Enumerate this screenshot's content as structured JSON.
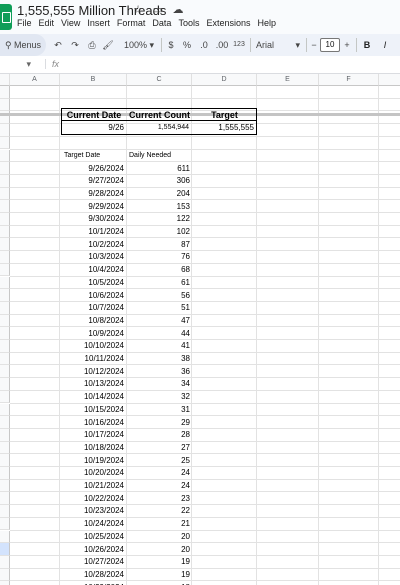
{
  "app": {
    "title": "1,555,555 Million Threads",
    "menu": [
      "File",
      "Edit",
      "View",
      "Insert",
      "Format",
      "Data",
      "Tools",
      "Extensions",
      "Help"
    ]
  },
  "toolbar": {
    "menus_label": "Menus",
    "zoom": "100%",
    "currency": "$",
    "percent": "%",
    "dec_decrease": ".0",
    "dec_increase": ".00",
    "number_format": "123",
    "font": "Arial",
    "font_size": "10",
    "bold": "B",
    "italic": "I"
  },
  "formula_bar": {
    "fx": "fx",
    "cell_ref": ""
  },
  "columns": [
    "A",
    "B",
    "C",
    "D",
    "E",
    "F",
    "G"
  ],
  "summary": {
    "headers": [
      "Current Date",
      "Current Count",
      "Target"
    ],
    "values": [
      "9/26",
      "1,554,944",
      "1,555,555"
    ]
  },
  "table": {
    "headers": [
      "Target Date",
      "Daily Needed"
    ],
    "rows": [
      [
        "9/26/2024",
        "611"
      ],
      [
        "9/27/2024",
        "306"
      ],
      [
        "9/28/2024",
        "204"
      ],
      [
        "9/29/2024",
        "153"
      ],
      [
        "9/30/2024",
        "122"
      ],
      [
        "10/1/2024",
        "102"
      ],
      [
        "10/2/2024",
        "87"
      ],
      [
        "10/3/2024",
        "76"
      ],
      [
        "10/4/2024",
        "68"
      ],
      [
        "10/5/2024",
        "61"
      ],
      [
        "10/6/2024",
        "56"
      ],
      [
        "10/7/2024",
        "51"
      ],
      [
        "10/8/2024",
        "47"
      ],
      [
        "10/9/2024",
        "44"
      ],
      [
        "10/10/2024",
        "41"
      ],
      [
        "10/11/2024",
        "38"
      ],
      [
        "10/12/2024",
        "36"
      ],
      [
        "10/13/2024",
        "34"
      ],
      [
        "10/14/2024",
        "32"
      ],
      [
        "10/15/2024",
        "31"
      ],
      [
        "10/16/2024",
        "29"
      ],
      [
        "10/17/2024",
        "28"
      ],
      [
        "10/18/2024",
        "27"
      ],
      [
        "10/19/2024",
        "25"
      ],
      [
        "10/20/2024",
        "24"
      ],
      [
        "10/21/2024",
        "24"
      ],
      [
        "10/22/2024",
        "23"
      ],
      [
        "10/23/2024",
        "22"
      ],
      [
        "10/24/2024",
        "21"
      ],
      [
        "10/25/2024",
        "20"
      ],
      [
        "10/26/2024",
        "20"
      ],
      [
        "10/27/2024",
        "19"
      ],
      [
        "10/28/2024",
        "19"
      ],
      [
        "10/29/2024",
        "18"
      ],
      [
        "10/30/2024",
        "17"
      ]
    ]
  }
}
